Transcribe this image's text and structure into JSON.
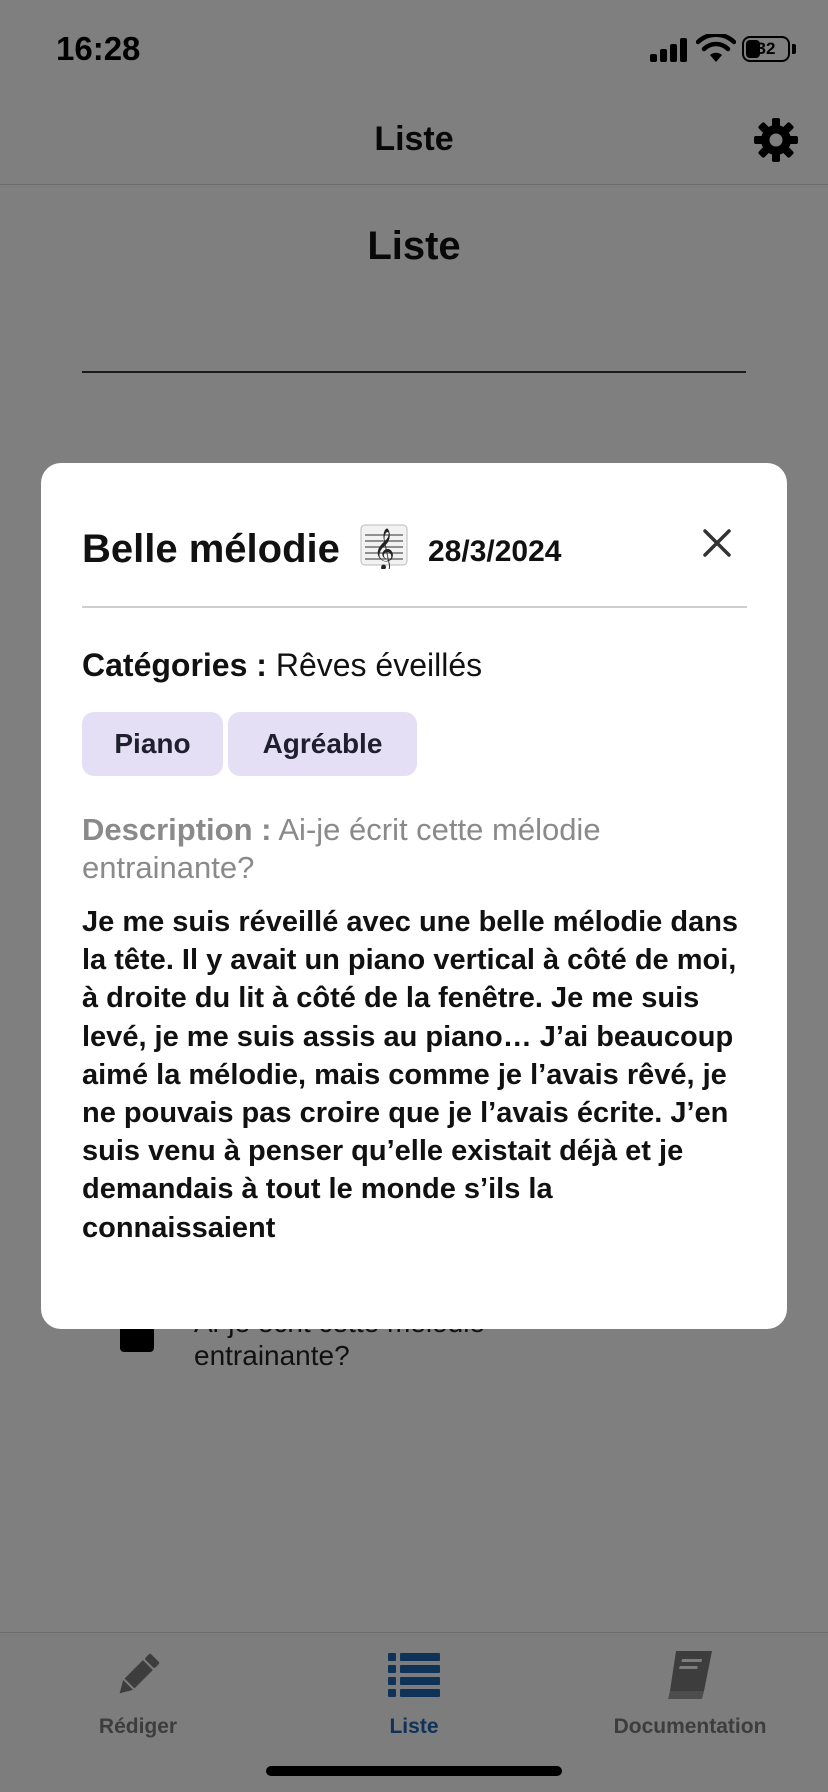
{
  "status_bar": {
    "time": "16:28",
    "battery_level": "32"
  },
  "header": {
    "title": "Liste",
    "settings_icon": "gear-icon"
  },
  "page": {
    "title": "Liste"
  },
  "list_item": {
    "text_line1": "Ai-je écrit cette mélodie",
    "text_line2": "entrainante?"
  },
  "modal": {
    "title": "Belle mélodie",
    "title_icon": "treble-clef-icon",
    "date": "28/3/2024",
    "close_icon": "close-icon",
    "categories_label": "Catégories :",
    "categories_value": "Rêves éveillés",
    "tags": [
      "Piano",
      "Agréable"
    ],
    "description_label": "Description :",
    "description_value": "Ai-je écrit cette mélodie entrainante?",
    "body": "Je me suis réveillé avec une belle mélodie dans la tête. Il y avait un piano vertical à côté de moi, à droite du lit à côté de la fenêtre. Je me suis levé, je me suis assis au piano… J’ai beaucoup aimé la mélodie, mais comme je l’avais rêvé, je ne pouvais pas croire que je l’avais écrite. J’en suis venu à penser qu’elle existait déjà et je demandais à tout le monde s’ils la connaissaient"
  },
  "tabs": [
    {
      "label": "Rédiger",
      "icon": "pencil-icon",
      "active": false
    },
    {
      "label": "Liste",
      "icon": "list-icon",
      "active": true
    },
    {
      "label": "Documentation",
      "icon": "book-icon",
      "active": false
    }
  ],
  "colors": {
    "accent": "#1f64b0",
    "chip_background": "#e5dff5",
    "inactive_tab": "#7a7a7a"
  }
}
